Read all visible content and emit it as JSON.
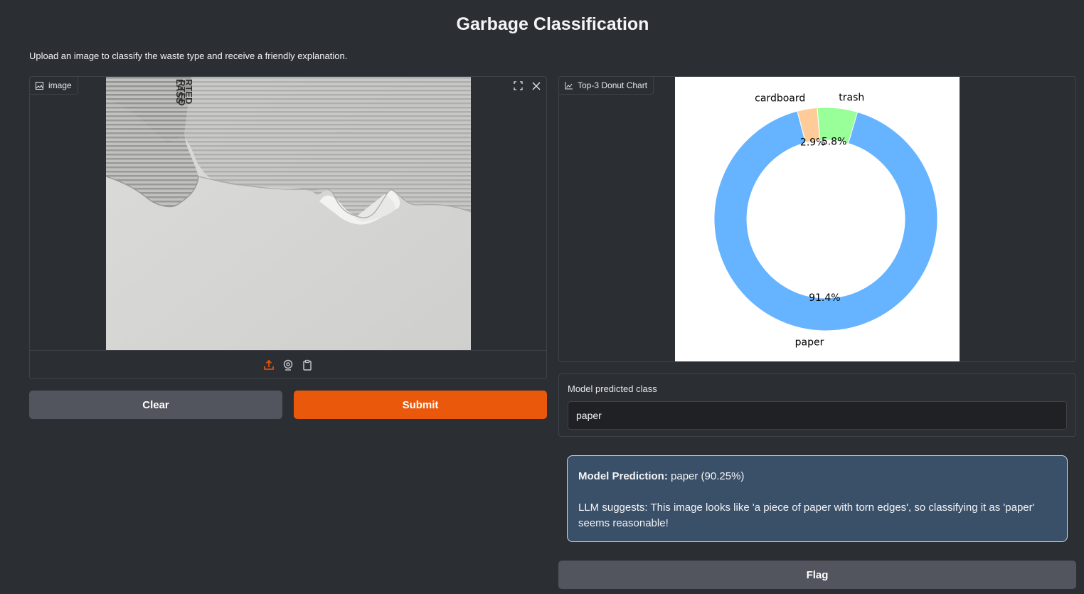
{
  "page": {
    "title": "Garbage Classification",
    "description": "Upload an image to classify the waste type and receive a friendly explanation."
  },
  "image_input": {
    "label": "image",
    "photo_text": "RTED LASS"
  },
  "buttons": {
    "clear": "Clear",
    "submit": "Submit",
    "flag": "Flag"
  },
  "chart_panel": {
    "label": "Top-3 Donut Chart"
  },
  "chart_data": {
    "type": "pie",
    "style": "donut",
    "categories": [
      "paper",
      "cardboard",
      "trash"
    ],
    "values": [
      91.4,
      2.9,
      5.8
    ],
    "value_labels": [
      "91.4%",
      "2.9%",
      "5.8%"
    ],
    "colors": [
      "#66b3ff",
      "#ffcc99",
      "#99ff99"
    ]
  },
  "predicted_class": {
    "label": "Model predicted class",
    "value": "paper"
  },
  "explanation": {
    "prediction_label": "Model Prediction:",
    "prediction_value": "paper (90.25%)",
    "llm_text": "LLM suggests: This image looks like 'a piece of paper with torn edges', so classifying it as 'paper' seems reasonable!"
  },
  "icons": {
    "image_label": "image-icon",
    "chart_label": "chart-icon",
    "fullscreen": "fullscreen-icon",
    "close": "close-icon",
    "upload": "upload-icon",
    "webcam": "webcam-icon",
    "clipboard": "clipboard-icon"
  },
  "colors": {
    "accent": "#ea580c",
    "background": "#2b2e33",
    "secondary_button": "#52555d",
    "explanation_bg": "#3a5069"
  }
}
